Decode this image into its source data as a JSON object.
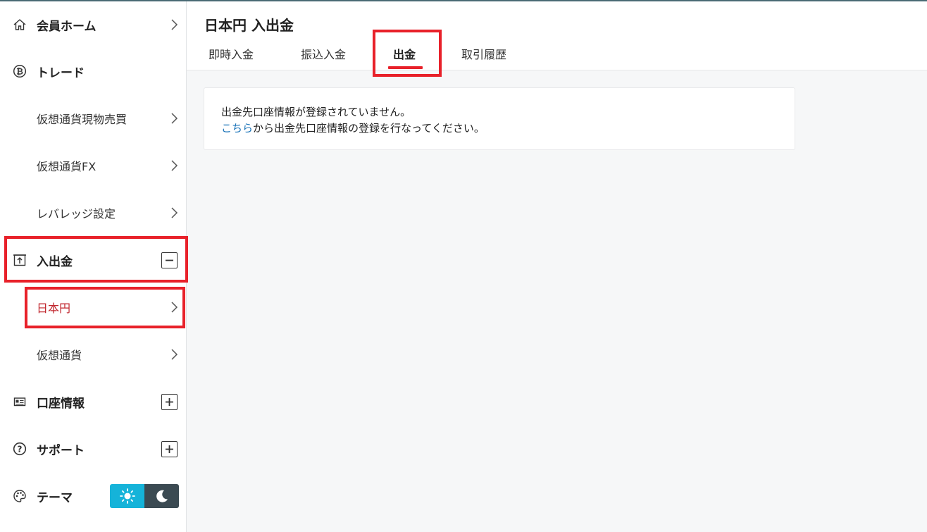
{
  "sidebar": {
    "home": "会員ホーム",
    "trade": "トレード",
    "trade_items": [
      "仮想通貨現物売買",
      "仮想通貨FX",
      "レバレッジ設定"
    ],
    "deposit": "入出金",
    "deposit_items": [
      "日本円",
      "仮想通貨"
    ],
    "account": "口座情報",
    "support": "サポート",
    "theme": "テーマ"
  },
  "header": {
    "title": "日本円 入出金",
    "tabs": [
      "即時入金",
      "振込入金",
      "出金",
      "取引履歴"
    ],
    "active_tab": "出金"
  },
  "notice": {
    "line1": "出金先口座情報が登録されていません。",
    "link": "こちら",
    "line2_rest": "から出金先口座情報の登録を行なってください。"
  },
  "colors": {
    "accent_red": "#e8212a",
    "active_text": "#c0262d",
    "link": "#1a73b8",
    "theme_light": "#15b3d9",
    "theme_dark": "#3b4a52"
  }
}
